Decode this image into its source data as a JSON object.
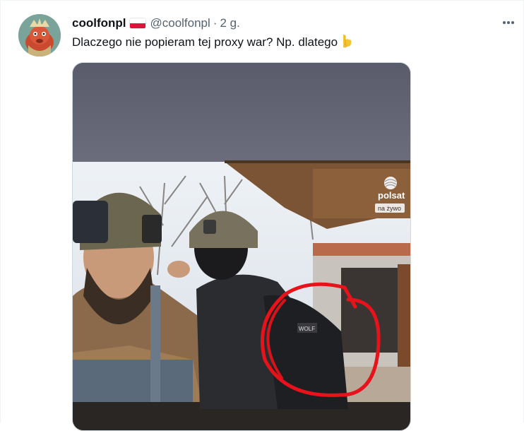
{
  "tweet": {
    "display_name": "coolfonpl",
    "handle": "@coolfonpl",
    "separator": "·",
    "time": "2 g.",
    "text": "Dlaczego nie popieram tej proxy war? Np. dlatego",
    "more_label": "•••"
  },
  "media": {
    "broadcaster_logo": "polsat",
    "broadcaster_badge": "na żywo",
    "patch_text": "WOLF"
  },
  "colors": {
    "text_primary": "#0f1419",
    "text_secondary": "#536471",
    "annotation_circle": "#e8121b",
    "flag_white": "#ffffff",
    "flag_red": "#dc143c"
  },
  "icons": {
    "more": "more-horizontal-icon",
    "emoji": "backhand-index-pointing-down-emoji",
    "flag": "poland-flag-icon"
  }
}
